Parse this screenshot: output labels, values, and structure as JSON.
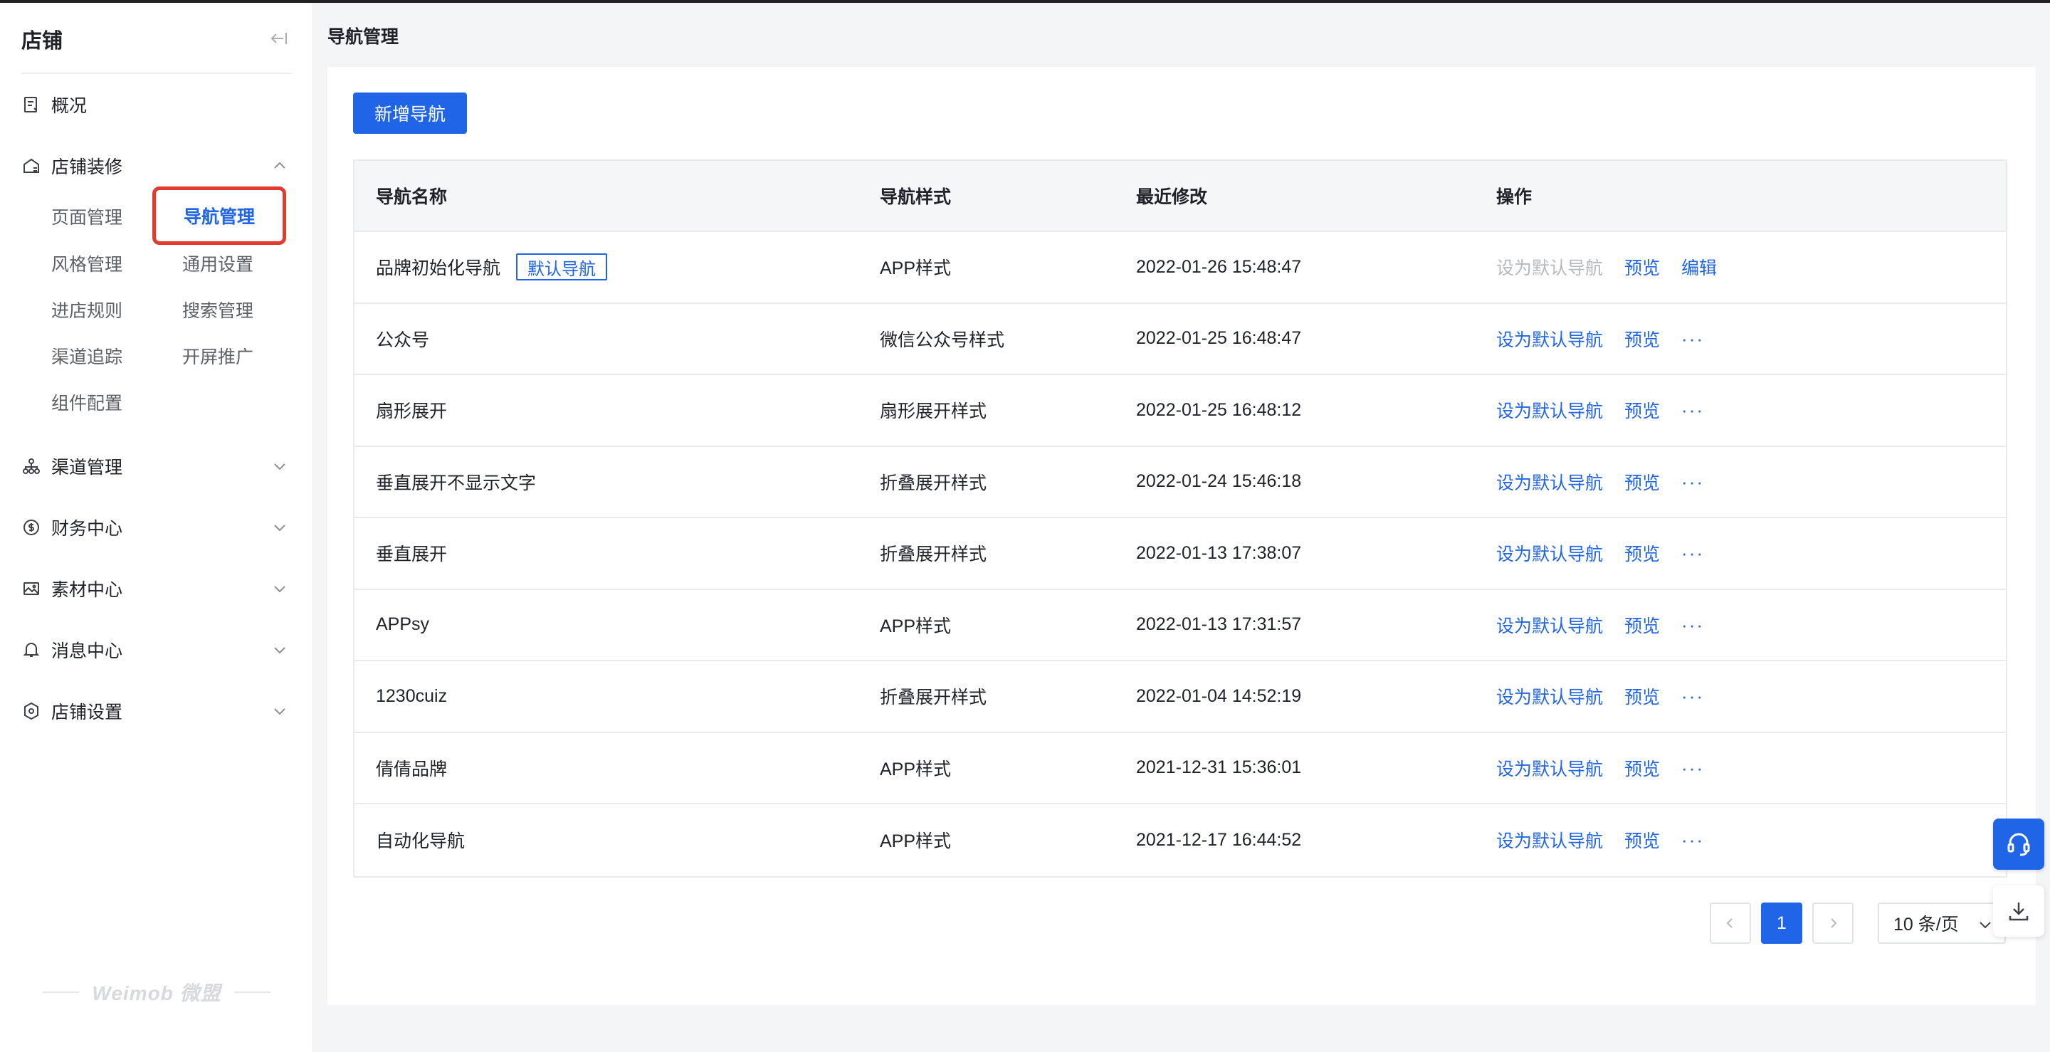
{
  "sidebar": {
    "title": "店铺",
    "overview": "概况",
    "decoration": {
      "label": "店铺装修",
      "subs": [
        "页面管理",
        "导航管理",
        "风格管理",
        "通用设置",
        "进店规则",
        "搜索管理",
        "渠道追踪",
        "开屏推广",
        "组件配置"
      ]
    },
    "channel": "渠道管理",
    "finance": "财务中心",
    "material": "素材中心",
    "message": "消息中心",
    "settings": "店铺设置",
    "footer_logo": "Weimob 微盟"
  },
  "page": {
    "title": "导航管理",
    "add_button": "新增导航"
  },
  "table": {
    "headers": [
      "导航名称",
      "导航样式",
      "最近修改",
      "操作"
    ],
    "default_tag": "默认导航",
    "actions": {
      "set_default": "设为默认导航",
      "preview": "预览",
      "edit": "编辑",
      "more": "···"
    },
    "rows": [
      {
        "name": "品牌初始化导航",
        "style": "APP样式",
        "modified": "2022-01-26 15:48:47"
      },
      {
        "name": "公众号",
        "style": "微信公众号样式",
        "modified": "2022-01-25 16:48:47"
      },
      {
        "name": "扇形展开",
        "style": "扇形展开样式",
        "modified": "2022-01-25 16:48:12"
      },
      {
        "name": "垂直展开不显示文字",
        "style": "折叠展开样式",
        "modified": "2022-01-24 15:46:18"
      },
      {
        "name": "垂直展开",
        "style": "折叠展开样式",
        "modified": "2022-01-13 17:38:07"
      },
      {
        "name": "APPsy",
        "style": "APP样式",
        "modified": "2022-01-13 17:31:57"
      },
      {
        "name": "1230cuiz",
        "style": "折叠展开样式",
        "modified": "2022-01-04 14:52:19"
      },
      {
        "name": "倩倩品牌",
        "style": "APP样式",
        "modified": "2021-12-31 15:36:01"
      },
      {
        "name": "自动化导航",
        "style": "APP样式",
        "modified": "2021-12-17 16:44:52"
      }
    ]
  },
  "pagination": {
    "current": "1",
    "page_size": "10 条/页"
  },
  "colors": {
    "primary": "#2064e8",
    "highlight_border": "#e23a2e"
  }
}
